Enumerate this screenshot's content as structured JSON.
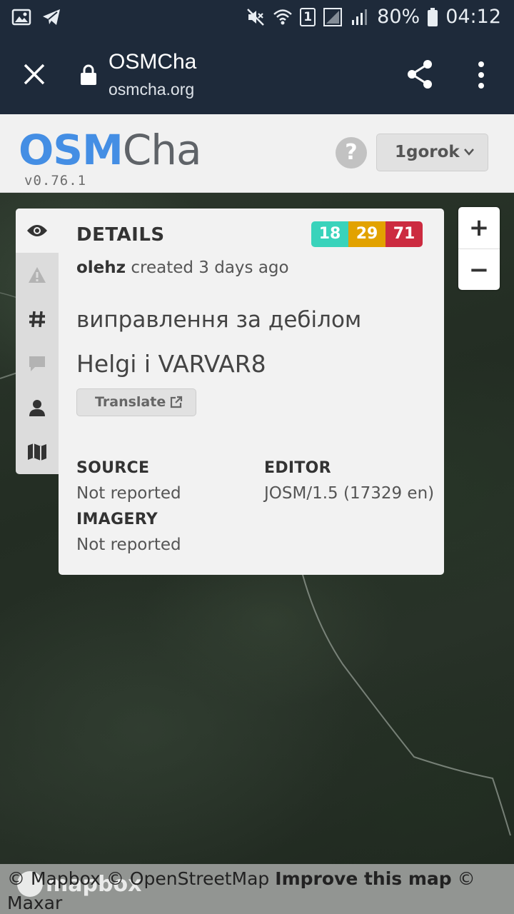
{
  "status_bar": {
    "battery": "80%",
    "time": "04:12",
    "sim_slot": "1"
  },
  "browser": {
    "title": "OSMCha",
    "url": "osmcha.org"
  },
  "app": {
    "logo_primary": "OSM",
    "logo_secondary": "Cha",
    "version": "v0.76.1",
    "help_label": "?",
    "user": "1gorok"
  },
  "side_tabs": [
    {
      "name": "eye-icon",
      "active": true
    },
    {
      "name": "warning-icon",
      "active": false
    },
    {
      "name": "hash-icon",
      "active": false
    },
    {
      "name": "comment-icon",
      "active": false
    },
    {
      "name": "user-icon",
      "active": false
    },
    {
      "name": "map-icon",
      "active": false
    }
  ],
  "details": {
    "title": "DETAILS",
    "counts": {
      "created": "18",
      "modified": "29",
      "deleted": "71"
    },
    "colors": {
      "created": "#39d3bb",
      "modified": "#e2a200",
      "deleted": "#cc2b40"
    },
    "author": "olehz",
    "created_text": "created 3 days ago",
    "comment_line1": "виправлення за дебілом",
    "comment_line2": "Helgi i VARVAR8",
    "translate_label": "Translate",
    "source_label": "SOURCE",
    "source_value": "Not reported",
    "editor_label": "EDITOR",
    "editor_value": "JOSM/1.5 (17329 en)",
    "imagery_label": "IMAGERY",
    "imagery_value": "Not reported"
  },
  "zoom": {
    "in": "+",
    "out": "−"
  },
  "attribution": {
    "mapbox": "© Mapbox",
    "osm": "© OpenStreetMap",
    "improve": "Improve this map",
    "maxar": "© Maxar",
    "logo_text": "mapbox"
  }
}
